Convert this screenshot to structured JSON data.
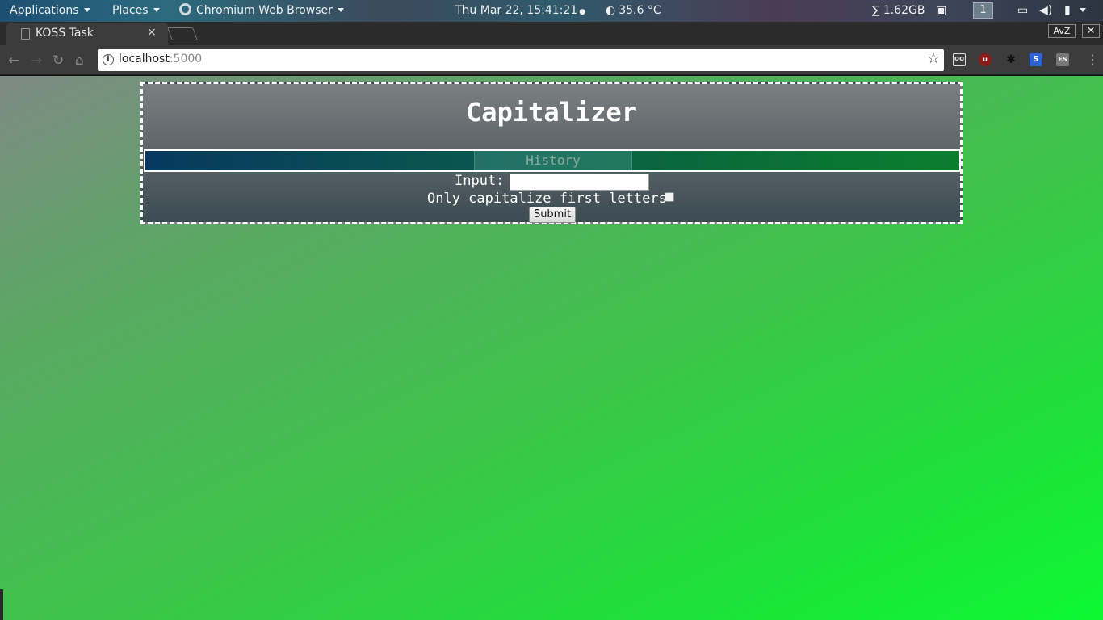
{
  "panel": {
    "applications": "Applications",
    "places": "Places",
    "active_app": "Chromium Web Browser",
    "clock": "Thu Mar 22, 15:41:21",
    "temperature": "35.6 °C",
    "memory": "∑ 1.62GB",
    "workspace": "1"
  },
  "browser": {
    "tab_title": "KOSS Task",
    "tab_close": "×",
    "avz_label": "AvZ",
    "window_close": "✕",
    "url_host": "localhost",
    "url_port": ":5000",
    "extensions": [
      "ghostery-icon",
      "ublock-icon",
      "paw-icon",
      "s-icon",
      "es-icon"
    ],
    "ext_labels": {
      "s": "S",
      "es": "ES"
    }
  },
  "app": {
    "title": "Capitalizer",
    "nav": {
      "history": "History"
    },
    "form": {
      "input_label": "Input:",
      "input_value": "",
      "checkbox_label": "Only capitalize first letters",
      "checkbox_checked": false,
      "submit_label": "Submit"
    }
  },
  "colors": {
    "background_start": "#7f8a84",
    "background_end": "#0df932",
    "nav_start": "#06395f",
    "nav_end": "#0a7f2d"
  }
}
